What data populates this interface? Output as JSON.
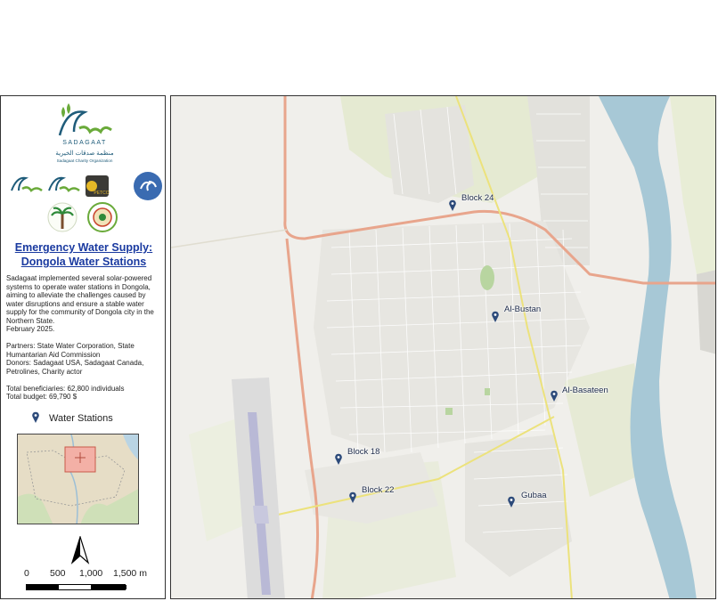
{
  "legend_panel": {
    "logos": {
      "main_caption_arabic": "منظمة صدقات الخيرية",
      "main_caption_english": "Sadagaat Charity Organization",
      "brand_wordmark": "SADAGAAT",
      "partner_logo_label": "PETCO"
    },
    "title_line1": "Emergency Water Supply:",
    "title_line2": "Dongola Water Stations",
    "description": "Sadagaat implemented several solar-powered systems to operate water stations in Dongola, aiming to alleviate the challenges caused by water disruptions and ensure a stable water supply for the community of Dongola city in the Northern State.",
    "date": " February 2025.",
    "partners": "Partners: State Water Corporation, State Humantarian Aid Commission",
    "donors": "Donors: Sadagaat USA, Sadagaat Canada, Petrolines, Charity actor",
    "beneficiaries": "Total beneficiaries: 62,800 individuals",
    "budget": "Total budget: 69,790 $",
    "legend_item": "Water Stations",
    "scale_labels": [
      "0",
      "500",
      "1,000",
      "1,500 m"
    ],
    "north_arrow_icon": "north-arrow-icon"
  },
  "map": {
    "stations": [
      {
        "name": "Block 24"
      },
      {
        "name": "Al-Bustan"
      },
      {
        "name": "Al-Basateen"
      },
      {
        "name": "Block 18"
      },
      {
        "name": "Block 22"
      },
      {
        "name": "Gubaa"
      }
    ],
    "colors": {
      "river": "#a7c8d6",
      "land": "#f0efeb",
      "farmland": "#e5ead2",
      "main_road": "#e8a58c",
      "secondary_road": "#ece27c",
      "airport_runway": "#b9b9d6",
      "station_marker": "#2c4a7a",
      "title": "#1a3aa0"
    }
  }
}
